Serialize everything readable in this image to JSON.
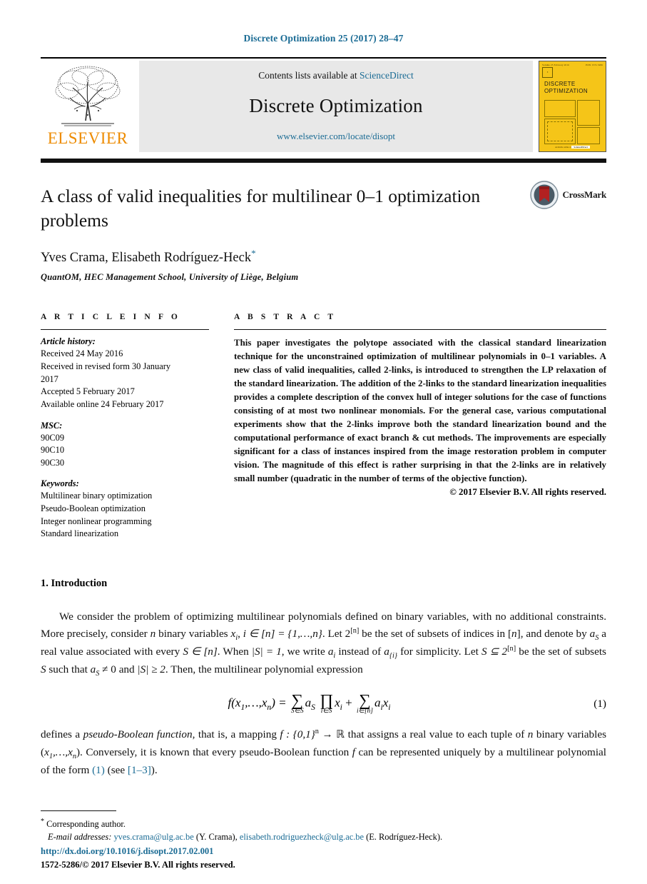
{
  "running_head": "Discrete Optimization 25 (2017) 28–47",
  "masthead": {
    "publisher_wordmark": "ELSEVIER",
    "contents_prefix": "Contents lists available at",
    "contents_link": "ScienceDirect",
    "journal_name": "Discrete Optimization",
    "journal_url": "www.elsevier.com/locate/disopt",
    "cover": {
      "volume_line": "Volume 25  February 2016",
      "issn_line": "ISSN 1572-5286",
      "title_line_1": "DISCRETE",
      "title_line_2": "OPTIMIZATION",
      "footer_line": "Available online at",
      "footer_brand": "ScienceDirect"
    }
  },
  "article": {
    "title": "A class of valid inequalities for multilinear 0–1 optimization problems",
    "authors": "Yves Crama, Elisabeth Rodríguez-Heck",
    "corresponding_marker": "*",
    "affiliation": "QuantOM, HEC Management School, University of Liège, Belgium",
    "crossmark_label": "CrossMark"
  },
  "article_info": {
    "heading": "A R T I C L E    I N F O",
    "history_label": "Article history:",
    "history": [
      "Received 24 May 2016",
      "Received in revised form 30 January",
      "2017",
      "Accepted 5 February 2017",
      "Available online 24 February 2017"
    ],
    "msc_label": "MSC:",
    "msc": [
      "90C09",
      "90C10",
      "90C30"
    ],
    "keywords_label": "Keywords:",
    "keywords": [
      "Multilinear binary optimization",
      "Pseudo-Boolean optimization",
      "Integer nonlinear programming",
      "Standard linearization"
    ]
  },
  "abstract": {
    "heading": "A B S T R A C T",
    "text": "This paper investigates the polytope associated with the classical standard linearization technique for the unconstrained optimization of multilinear polynomials in 0–1 variables. A new class of valid inequalities, called 2-links, is introduced to strengthen the LP relaxation of the standard linearization. The addition of the 2-links to the standard linearization inequalities provides a complete description of the convex hull of integer solutions for the case of functions consisting of at most two nonlinear monomials. For the general case, various computational experiments show that the 2-links improve both the standard linearization bound and the computational performance of exact branch & cut methods. The improvements are especially significant for a class of instances inspired from the image restoration problem in computer vision. The magnitude of this effect is rather surprising in that the 2-links are in relatively small number (quadratic in the number of terms of the objective function).",
    "copyright": "© 2017 Elsevier B.V. All rights reserved."
  },
  "introduction": {
    "heading": "1. Introduction",
    "paragraph_1_part_1": "We consider the problem of optimizing multilinear polynomials defined on binary variables, with no additional constraints. More precisely, consider ",
    "n_1": "n",
    "p1_b": " binary variables ",
    "x_i": "x",
    "sub_i": "i",
    "p1_c": ", ",
    "i_in": "i ∈ [n] = {1,…,n}",
    "p1_d": ". Let 2",
    "sup_n": "[n]",
    "p1_e": " be the set of subsets of indices in [",
    "n_2": "n",
    "p1_f": "], and denote by ",
    "a_S": "a",
    "sub_S": "S",
    "p1_g": " a real value associated with every ",
    "S_in_n": "S ∈ [n]",
    "p1_h": ". When ",
    "absS1": "|S| = 1",
    "p1_i": ", we write ",
    "a_i": "a",
    "p1_j": " instead of ",
    "a_brace_i": "a",
    "sub_brace_i": "{i}",
    "p1_k": " for simplicity. Let ",
    "S_subset": "S ⊆ 2",
    "p1_l": " be the set of subsets ",
    "S_var": "S",
    "p1_m": " such that ",
    "aS_ne_0": "a",
    "p1_n": " ≠ 0 and ",
    "absS2": "|S| ≥ 2",
    "p1_o": ". Then, the multilinear polynomial expression",
    "equation": {
      "lhs": "f(x",
      "lhs_sub": "1",
      "lhs_mid": ",…,x",
      "lhs_sub2": "n",
      "lhs_end": ") =",
      "sum1_glyph": "∑",
      "sum1_lim": "S∈S",
      "coef1": "a",
      "coef1_sub": "S",
      "prod_glyph": "∏",
      "prod_lim": "i∈S",
      "var1": "x",
      "var1_sub": "i",
      "plus": "+",
      "sum2_glyph": "∑",
      "sum2_lim": "i∈[n]",
      "coef2": "a",
      "coef2_sub": "i",
      "var2": "x",
      "var2_sub": "i",
      "number": "(1)"
    },
    "paragraph_2_a": "defines a ",
    "pb_italic": "pseudo-Boolean function",
    "paragraph_2_b": ", that is, a mapping ",
    "mapping": "f : {0,1}",
    "mapping_sup": "n",
    "mapping_arrow": " → ℝ",
    "paragraph_2_c": " that assigns a real value to each tuple of ",
    "n_3": "n",
    "paragraph_2_d": " binary variables (",
    "tuple": "x",
    "tuple_sub1": "1",
    "tuple_mid": ",…,x",
    "tuple_sub2": "n",
    "paragraph_2_e": "). Conversely, it is known that every pseudo-Boolean function ",
    "f_var": "f",
    "paragraph_2_f": " can be represented uniquely by a multilinear polynomial of the form ",
    "ref_eq": "(1)",
    "paragraph_2_g": " (see ",
    "ref_cite": "[1–3]",
    "paragraph_2_h": ")."
  },
  "footnotes": {
    "corresponding": "Corresponding author.",
    "email_label": "E-mail addresses:",
    "email_1": "yves.crama@ulg.ac.be",
    "email_1_owner": "(Y. Crama),",
    "email_2": "elisabeth.rodriguezheck@ulg.ac.be",
    "email_2_owner": "(E. Rodríguez-Heck)."
  },
  "footer": {
    "doi": "http://dx.doi.org/10.1016/j.disopt.2017.02.001",
    "issn": "1572-5286/© 2017 Elsevier B.V. All rights reserved."
  },
  "colors": {
    "link_blue": "#1a6b94",
    "elsevier_orange": "#ED8B00",
    "cover_yellow": "#F5C518",
    "crossmark_red": "#b22121"
  }
}
